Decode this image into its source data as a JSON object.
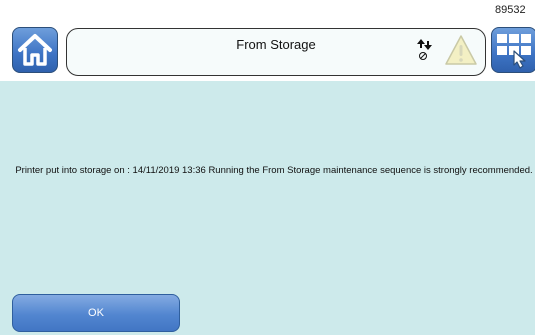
{
  "device": {
    "id_label": "89532"
  },
  "header": {
    "title": "From Storage",
    "home_icon": "home-icon",
    "status_icon": "transfer-arrows-icon",
    "warning_icon": "warning-triangle-icon",
    "menu_icon": "grid-menu-touch-icon"
  },
  "main": {
    "message": "Printer put into storage on : 14/11/2019  13:36 Running the From Storage maintenance sequence is strongly recommended."
  },
  "footer": {
    "ok_label": "OK"
  },
  "colors": {
    "background": "#cdeaeb",
    "button_blue": "#4a7fce",
    "warning_yellow": "#f3f0c4"
  }
}
